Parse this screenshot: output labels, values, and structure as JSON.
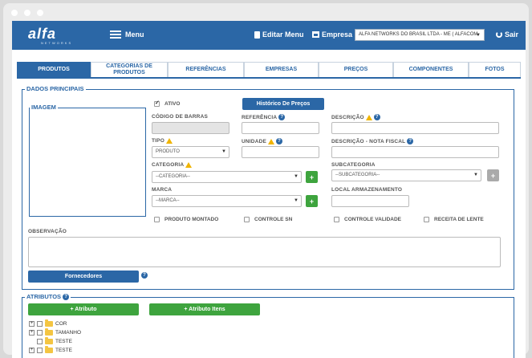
{
  "topbar": {
    "logo": "alfa",
    "logo_sub": "NETWORKS",
    "menu_label": "Menu",
    "editar_menu_label": "Editar Menu",
    "empresa_label": "Empresa",
    "empresa_value": "ALFA NETWORKS DO BRASIL LTDA - ME ( ALFACOM",
    "sair_label": "Sair"
  },
  "tabs": [
    {
      "label": "PRODUTOS",
      "active": true
    },
    {
      "label": "CATEGORIAS DE PRODUTOS",
      "active": false
    },
    {
      "label": "REFERÊNCIAS",
      "active": false
    },
    {
      "label": "EMPRESAS",
      "active": false
    },
    {
      "label": "PREÇOS",
      "active": false
    },
    {
      "label": "COMPONENTES",
      "active": false
    },
    {
      "label": "FOTOS",
      "active": false
    }
  ],
  "dados": {
    "legend": "DADOS PRINCIPAIS",
    "imagem_legend": "IMAGEM",
    "ativo_label": "ATIVO",
    "historico_btn": "Histórico De Preços",
    "codigo_barras_label": "CÓDIGO DE BARRAS",
    "referencia_label": "REFERÊNCIA",
    "descricao_label": "DESCRIÇÃO",
    "tipo_label": "TIPO",
    "tipo_value": "PRODUTO",
    "unidade_label": "UNIDADE",
    "descricao_nf_label": "DESCRIÇÃO - NOTA FISCAL",
    "categoria_label": "CATEGORIA",
    "categoria_value": "--CATEGORIA--",
    "subcategoria_label": "SUBCATEGORIA",
    "subcategoria_value": "--SUBCATEGORIA--",
    "marca_label": "MARCA",
    "marca_value": "--MARCA--",
    "local_label": "LOCAL ARMAZENAMENTO",
    "produto_montado_label": "PRODUTO MONTADO",
    "controle_sn_label": "CONTROLE SN",
    "controle_validade_label": "CONTROLE VALIDADE",
    "receita_lente_label": "RECEITA DE LENTE",
    "observacao_label": "OBSERVAÇÃO",
    "fornecedores_btn": "Fornecedores",
    "plus": "+"
  },
  "atributos": {
    "legend": "ATRIBUTOS",
    "add_atributo_btn": "+ Atributo",
    "add_atributo_itens_btn": "+ Atributo Itens",
    "tree": [
      {
        "label": "COR",
        "expandable": true
      },
      {
        "label": "TAMANHO",
        "expandable": true
      },
      {
        "label": "TESTE",
        "expandable": false
      },
      {
        "label": "TESTE",
        "expandable": true
      }
    ]
  },
  "colors": {
    "primary": "#2b67a6",
    "green": "#3ea43e",
    "warning": "#f0b400"
  }
}
